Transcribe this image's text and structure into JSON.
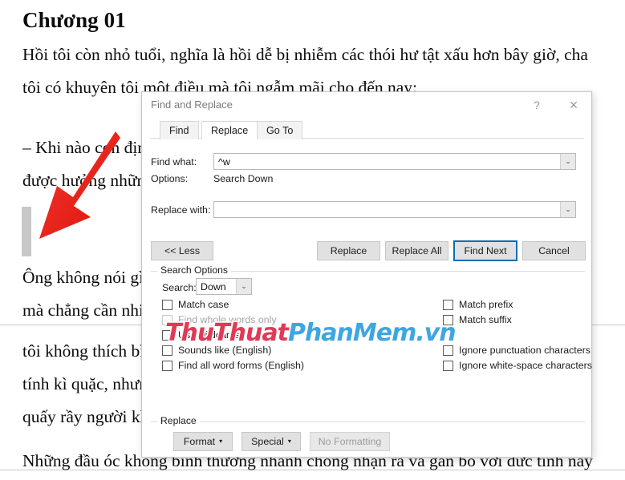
{
  "document": {
    "heading": "Chương 01",
    "paragraphs": [
      "Hồi tôi còn nhỏ tuổi, nghĩa là hồi dễ bị nhiễm các thói hư tật xấu hơn bây giờ, cha",
      "tôi có khuyên tôi một điều mà tôi ngẫm mãi cho đến nay:",
      "– Khi nào con định phê bình người khác, con nên nhớ rằng không phải ai cũng",
      "được hưởng những thuận lợi mà con có.",
      "Ông không nói gì thêm, nhưng chúng tôi vốn vẫn hiểu nhau một cách kín đáo sau",
      "mà chẳng cần nhiều lời, nên tôi biết ông muốn nói nhiều hơn thế. Kết quả là bây",
      "tôi không thích bình phẩm mọi người. Thói quen ấy làm cho tôi khám phá ra bản",
      "tính kì quặc, nhưng cũng khiến tôi trở thành nạn nhân của không ít kẻ chuyên",
      "quấy rầy người khác.",
      "Những đầu óc không bình thường nhanh chóng nhận ra và gắn bó với đức tính này"
    ]
  },
  "dialog": {
    "title": "Find and Replace",
    "help_icon": "?",
    "close_icon": "✕",
    "tabs": [
      {
        "label": "Find",
        "active": false
      },
      {
        "label": "Replace",
        "active": true
      },
      {
        "label": "Go To",
        "active": false
      }
    ],
    "fields": {
      "find_what_label": "Find what:",
      "find_what_value": "^w",
      "options_label": "Options:",
      "options_value": "Search Down",
      "replace_with_label": "Replace with:",
      "replace_with_value": "",
      "dropdown_icon": "⌄"
    },
    "buttons": {
      "less": "<< Less",
      "replace": "Replace",
      "replace_all": "Replace All",
      "find_next": "Find Next",
      "cancel": "Cancel"
    },
    "search_options": {
      "group_title": "Search Options",
      "search_label": "Search:",
      "search_value": "Down",
      "left_checkboxes": [
        {
          "label": "Match case",
          "checked": false,
          "disabled": false
        },
        {
          "label": "Find whole words only",
          "checked": false,
          "disabled": true
        },
        {
          "label": "Use wildcards",
          "checked": false,
          "disabled": false
        },
        {
          "label": "Sounds like (English)",
          "checked": false,
          "disabled": false
        },
        {
          "label": "Find all word forms (English)",
          "checked": false,
          "disabled": false
        }
      ],
      "right_checkboxes": [
        {
          "label": "Match prefix",
          "checked": false,
          "disabled": false
        },
        {
          "label": "Match suffix",
          "checked": false,
          "disabled": false
        },
        {
          "label": "Ignore punctuation characters",
          "checked": false,
          "disabled": false
        },
        {
          "label": "Ignore white-space characters",
          "checked": false,
          "disabled": false
        }
      ]
    },
    "replace_group": {
      "group_title": "Replace",
      "format": "Format",
      "special": "Special",
      "no_formatting": "No Formatting",
      "caret_icon": "▾"
    }
  },
  "watermark": {
    "part1": "ThuThuat",
    "part2": "PhanMem",
    "part3": ".vn",
    "color1": "#e03a57",
    "color2": "#3ea6e0"
  },
  "annotation": {
    "arrow_color": "#e8241c",
    "arrow_name": "red-arrow-pointer"
  }
}
